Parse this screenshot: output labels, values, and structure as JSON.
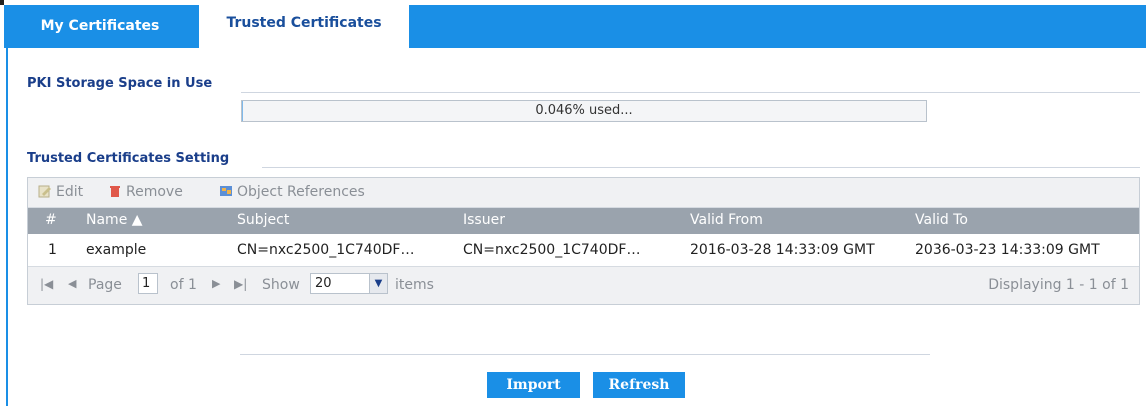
{
  "tabs": {
    "my_certificates": "My Certificates",
    "trusted_certificates": "Trusted Certificates"
  },
  "storage": {
    "title": "PKI Storage Space in Use",
    "usage_text": "0.046% used...",
    "usage_fraction": 0.00046
  },
  "settings": {
    "title": "Trusted Certificates Setting",
    "toolbar": {
      "edit": "Edit",
      "remove": "Remove",
      "object_references": "Object References"
    },
    "columns": {
      "num": "#",
      "name": "Name ▲",
      "subject": "Subject",
      "issuer": "Issuer",
      "valid_from": "Valid From",
      "valid_to": "Valid To"
    },
    "rows": [
      {
        "num": "1",
        "name": "example",
        "subject": "CN=nxc2500_1C740DF…",
        "issuer": "CN=nxc2500_1C740DF…",
        "valid_from": "2016-03-28 14:33:09 GMT",
        "valid_to": "2036-03-23 14:33:09 GMT"
      }
    ],
    "pager": {
      "page_label": "Page",
      "page_value": "1",
      "of_label": "of 1",
      "show_label": "Show",
      "show_value": "20",
      "items_label": "items",
      "displaying": "Displaying 1 - 1 of 1"
    }
  },
  "buttons": {
    "import": "Import",
    "refresh": "Refresh"
  },
  "colors": {
    "accent": "#1a8fe6",
    "header": "#9aa3ad",
    "title": "#1a3e8a"
  }
}
